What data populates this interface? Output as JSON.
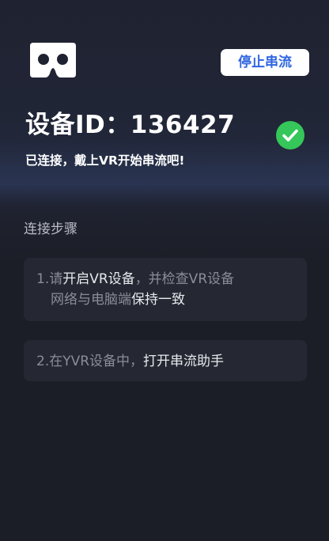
{
  "header": {
    "logo_icon": "vr-headset-icon",
    "stop_button_label": "停止串流"
  },
  "device": {
    "title": "设备ID：136427",
    "status_icon": "check-circle-icon",
    "status_color": "#35c759",
    "status_text": "已连接，戴上VR开始串流吧!"
  },
  "steps": {
    "heading": "连接步骤",
    "items": [
      {
        "line1": [
          {
            "text": "1.请",
            "style": "muted"
          },
          {
            "text": "开启VR设备",
            "style": "bright"
          },
          {
            "text": "，并检查VR设备",
            "style": "muted"
          }
        ],
        "line2": [
          {
            "text": "网络与电脑端",
            "style": "muted"
          },
          {
            "text": "保持一致",
            "style": "bright"
          }
        ]
      },
      {
        "line1": [
          {
            "text": "2.在YVR设备中，",
            "style": "muted"
          },
          {
            "text": "打开串流助手",
            "style": "bright"
          }
        ]
      }
    ]
  },
  "colors": {
    "background": "#1c1e27",
    "card": "#252833",
    "accent_blue": "#2f66e0"
  }
}
